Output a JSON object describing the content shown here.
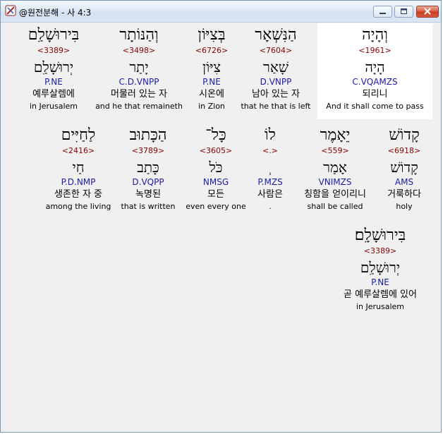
{
  "window": {
    "title": "@원전분해 - 사 4:3"
  },
  "rows": [
    {
      "words": [
        {
          "heb": "וְהָיָה",
          "strong": "<1961>",
          "lemma": "הָיָה",
          "morph": "C.VQAMZS",
          "kor": "되리니",
          "eng": "And it shall come to pass"
        },
        {
          "heb": "הַנִּשְׁאָר",
          "strong": "<7604>",
          "lemma": "שָׁאַר",
          "morph": "D.VNPP",
          "kor": "남아 있는 자",
          "eng": "that he that is left"
        },
        {
          "heb": "בְּצִיּוֹן",
          "strong": "<6726>",
          "lemma": "צִיּוֹן",
          "morph": "P.NE",
          "kor": "시온에",
          "eng": "in Zion"
        },
        {
          "heb": "וְהַנּוֹתָר",
          "strong": "<3498>",
          "lemma": "יָתַר",
          "morph": "C.D.VNPP",
          "kor": "머물러 있는 자",
          "eng": "and he that remaineth"
        },
        {
          "heb": "בִּירוּשָׁלַ͏ִם",
          "strong": "<3389>",
          "lemma": "יְרוּשָׁלַ͏ִם",
          "morph": "P.NE",
          "kor": "예루살렘에",
          "eng": "in Jerusalem"
        }
      ]
    },
    {
      "words": [
        {
          "heb": "קָדוֹשׁ",
          "strong": "<6918>",
          "lemma": "קָדוֹשׁ",
          "morph": "AMS",
          "kor": "거룩하다",
          "eng": "holy"
        },
        {
          "heb": "יֵאָמֶר",
          "strong": "<559>",
          "lemma": "אָמַר",
          "morph": "VNIMZS",
          "kor": "칭함을 얻이리니",
          "eng": "shall be called"
        },
        {
          "heb": "לוֹ",
          "strong": "<.>",
          "lemma": "ְ",
          "morph": "P.MZS",
          "kor": "사람은",
          "eng": "."
        },
        {
          "heb": "כָּל־",
          "strong": "<3605>",
          "lemma": "כֹּל",
          "morph": "NMSG",
          "kor": "모든",
          "eng": "even every one"
        },
        {
          "heb": "הַכָּתוּב",
          "strong": "<3789>",
          "lemma": "כָּתַב",
          "morph": "D.VQPP",
          "kor": "녹명된",
          "eng": "that is written"
        },
        {
          "heb": "לַחַיִּים",
          "strong": "<2416>",
          "lemma": "חַי",
          "morph": "P.D.NMP",
          "kor": "생존한 자 중",
          "eng": "among the living"
        }
      ]
    },
    {
      "words": [
        {
          "heb": "בִּירוּשָׁלָ͏ִם׃",
          "strong": "<3389>",
          "lemma": "יְרוּשָׁלַ͏ִם",
          "morph": "P.NE",
          "kor": "곧 예루살렘에 있어",
          "eng": "in Jerusalem"
        }
      ]
    }
  ]
}
